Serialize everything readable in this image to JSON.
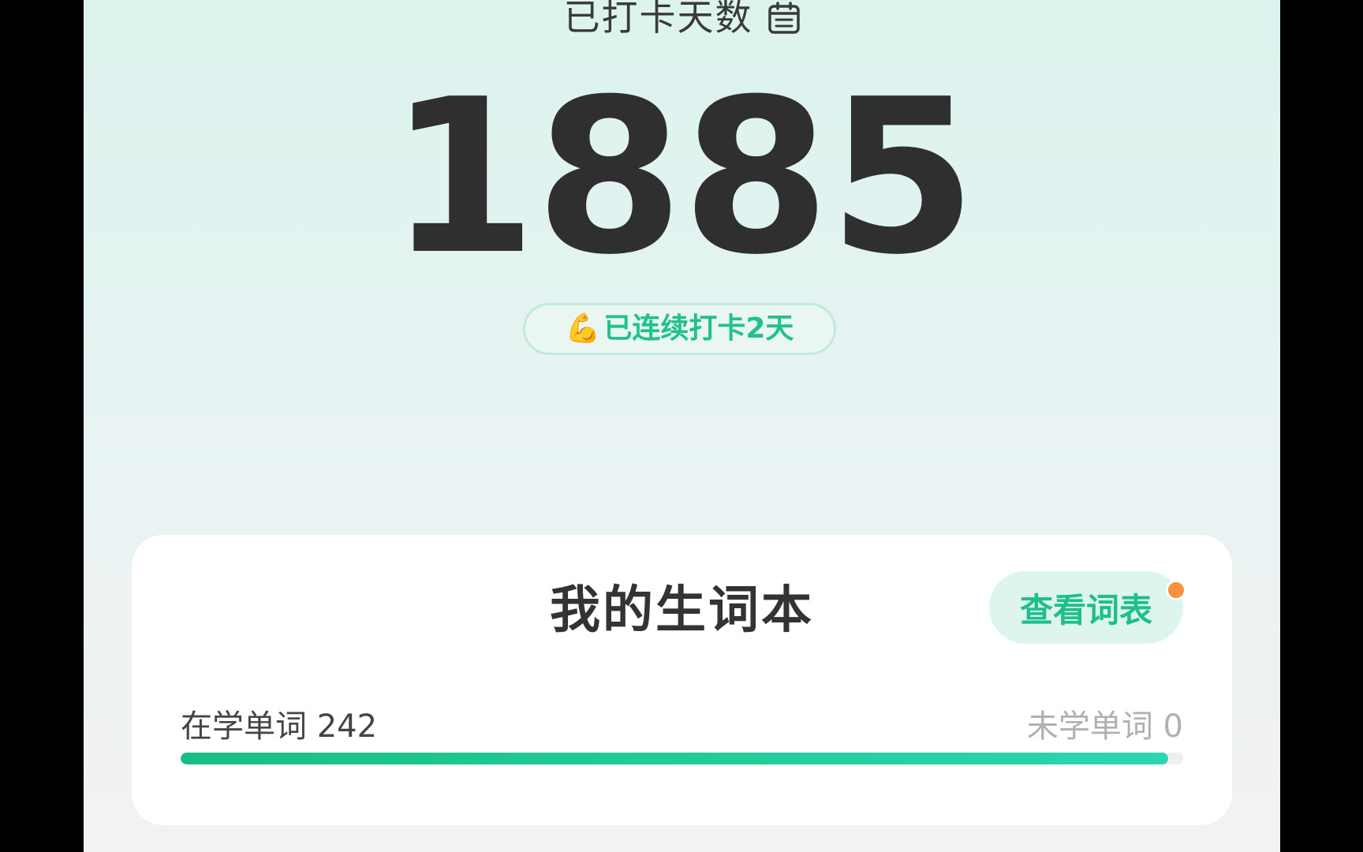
{
  "checkin": {
    "days_label": "已打卡天数",
    "days_count": "1885",
    "streak_emoji": "💪",
    "streak_text": "已连续打卡2天"
  },
  "vocab_book": {
    "title": "我的生词本",
    "view_list_label": "查看词表",
    "learning_label": "在学单词",
    "learning_count": "242",
    "unlearned_label": "未学单词",
    "unlearned_count": "0",
    "progress_fraction": 0.985
  },
  "colors": {
    "accent_green": "#20c18a",
    "notify_dot": "#f7913c",
    "text_dark": "#2f2f2f"
  },
  "icons": {
    "calendar": "calendar-icon"
  }
}
